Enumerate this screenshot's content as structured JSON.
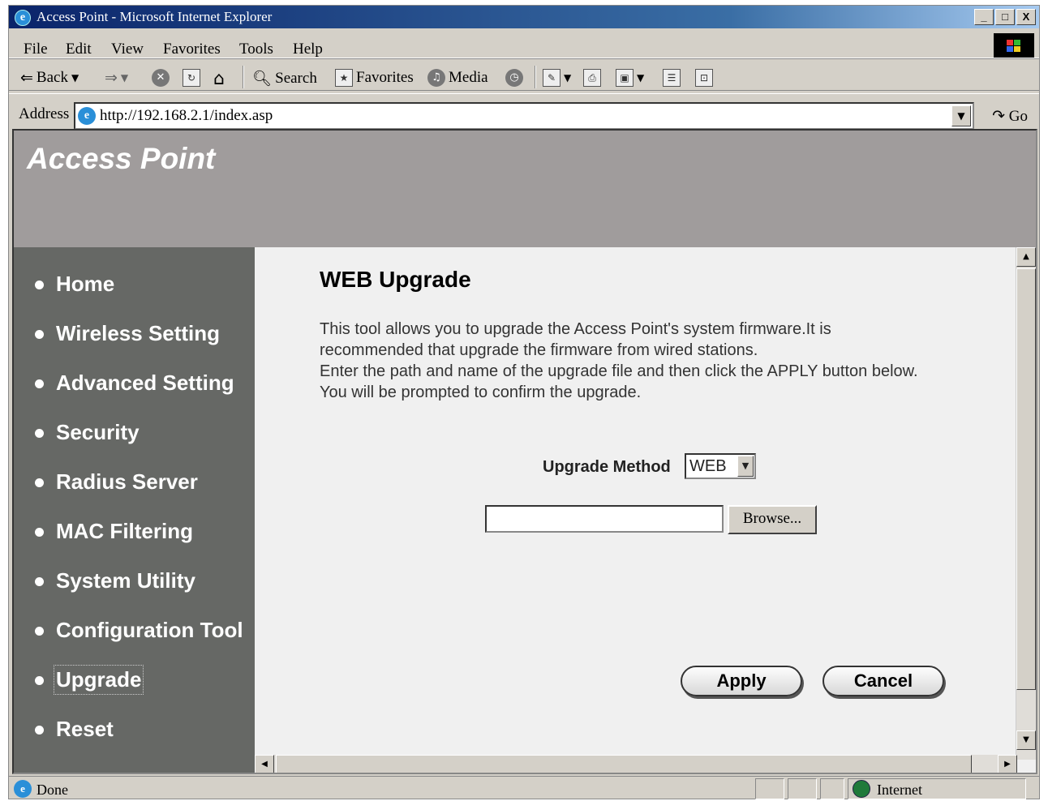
{
  "window": {
    "title": "Access Point - Microsoft Internet Explorer",
    "caption_buttons": [
      "_",
      "□",
      "X"
    ]
  },
  "menubar": [
    "File",
    "Edit",
    "View",
    "Favorites",
    "Tools",
    "Help"
  ],
  "toolbar": {
    "back": "Back",
    "search": "Search",
    "favorites": "Favorites",
    "media": "Media",
    "icons": [
      "back-icon",
      "forward-icon",
      "stop-icon",
      "refresh-icon",
      "home-icon",
      "search-icon",
      "favorites-icon",
      "media-icon",
      "history-icon",
      "edit-icon",
      "print-icon",
      "discuss-icon",
      "page-icon",
      "messenger-icon"
    ]
  },
  "address": {
    "label": "Address",
    "url": "http://192.168.2.1/index.asp",
    "go": "Go"
  },
  "banner": {
    "brand": "Access Point"
  },
  "sidebar": {
    "items": [
      {
        "label": "Home"
      },
      {
        "label": "Wireless Setting"
      },
      {
        "label": "Advanced Setting"
      },
      {
        "label": "Security"
      },
      {
        "label": "Radius Server"
      },
      {
        "label": "MAC Filtering"
      },
      {
        "label": "System Utility"
      },
      {
        "label": "Configuration Tool"
      },
      {
        "label": "Upgrade"
      },
      {
        "label": "Reset"
      }
    ],
    "active": "Upgrade"
  },
  "main": {
    "title": "WEB Upgrade",
    "description": [
      "This tool allows you to upgrade the Access Point's system firmware.It is",
      "recommended that upgrade the firmware from wired stations.",
      "Enter the path and name of the upgrade file and then click the APPLY button below.",
      "You will be prompted to confirm the upgrade."
    ],
    "upgrade_method_label": "Upgrade Method",
    "upgrade_method_value": "WEB",
    "file_value": "",
    "browse_label": "Browse...",
    "apply_label": "Apply",
    "cancel_label": "Cancel"
  },
  "status": {
    "text": "Done",
    "zone": "Internet"
  },
  "colors": {
    "sidebar": "#666865",
    "banner": "#a09c9c",
    "content_bg": "#f0f0f0",
    "titlebar": "#0a246a"
  }
}
